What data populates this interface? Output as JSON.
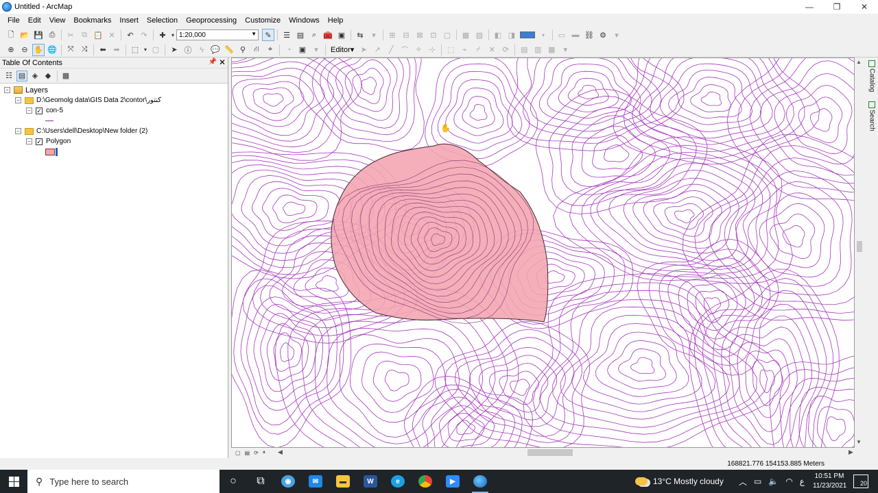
{
  "window": {
    "title": "Untitled - ArcMap",
    "minimize_icon": "minimize-icon",
    "maximize_icon": "maximize-icon",
    "close_icon": "close-icon"
  },
  "menu": [
    "File",
    "Edit",
    "View",
    "Bookmarks",
    "Insert",
    "Selection",
    "Geoprocessing",
    "Customize",
    "Windows",
    "Help"
  ],
  "toolbar": {
    "scale": "1:20,000",
    "editor_label": "Editor▾"
  },
  "toc": {
    "title": "Table Of Contents",
    "root": "Layers",
    "groups": [
      {
        "path": "D:\\Geomolg data\\GIS Data 2\\contor\\کنتور",
        "layer": "con-5",
        "checked": true,
        "symbol": "line"
      },
      {
        "path": "C:\\Users\\dell\\Desktop\\New folder (2)",
        "layer": "Polygon",
        "checked": true,
        "symbol": "polygon"
      }
    ]
  },
  "side_tabs": [
    "Catalog",
    "Search"
  ],
  "status": {
    "coordinates": "168821.776  154153.885 Meters"
  },
  "taskbar": {
    "search_placeholder": "Type here to search",
    "weather": "13°C  Mostly cloudy",
    "time": "10:51 PM",
    "date": "11/23/2021",
    "notifications": "20",
    "lang": "ع"
  },
  "colors": {
    "contour": "#9b1fb5",
    "polygon_fill": "#f4a4b0",
    "polygon_stroke": "#3a2a2a",
    "accent": "#3b7fd4"
  }
}
